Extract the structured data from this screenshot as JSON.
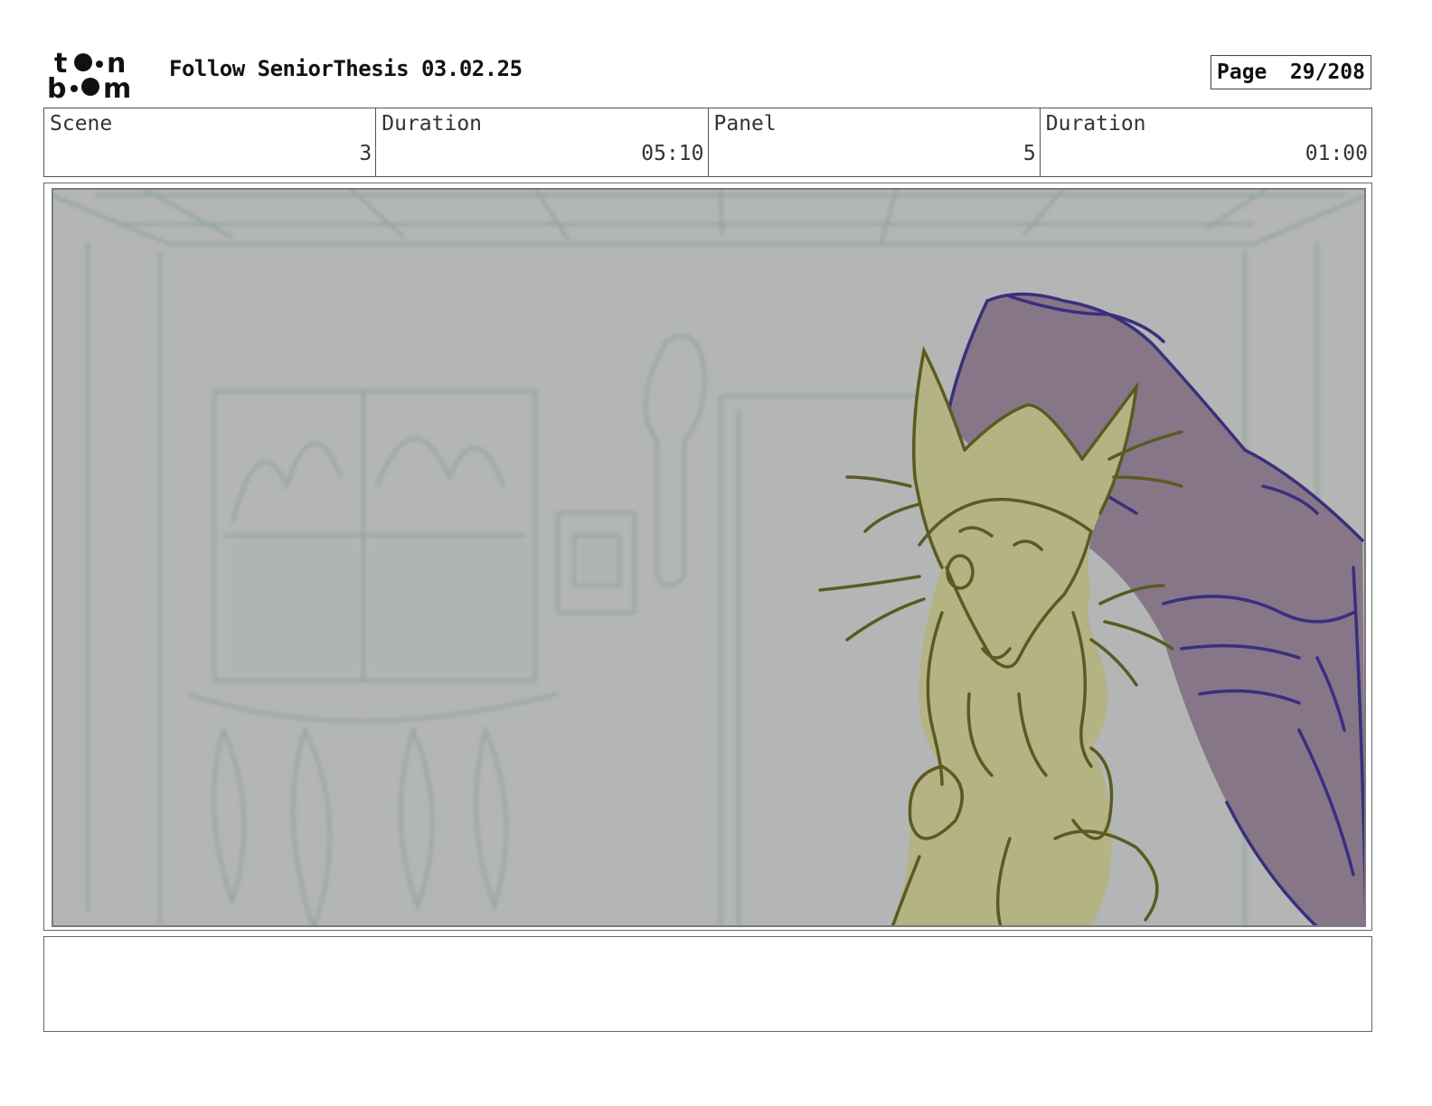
{
  "header": {
    "title": "Follow SeniorThesis 03.02.25",
    "page_label": "Page",
    "page_value": "29/208"
  },
  "logo": {
    "text_line1": "toon",
    "text_line2": "boom"
  },
  "info": {
    "scene_label": "Scene",
    "scene_value": "3",
    "scene_duration_label": "Duration",
    "scene_duration_value": "05:10",
    "panel_label": "Panel",
    "panel_value": "5",
    "panel_duration_label": "Duration",
    "panel_duration_value": "01:00"
  },
  "colors": {
    "background_fill": "#b4b5b5",
    "background_lines": "#8fa39a",
    "creature_fill": "#b3b383",
    "creature_lines": "#5b5a22",
    "hand_fill": "#867688",
    "hand_lines": "#3a2f7c"
  },
  "notes": {
    "text": ""
  }
}
